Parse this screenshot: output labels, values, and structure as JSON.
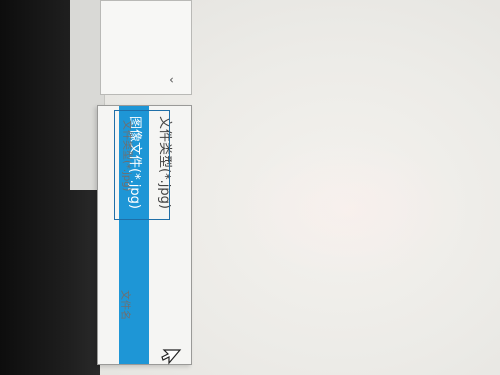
{
  "combo": {
    "arrow_icon": "chevron-down-icon"
  },
  "file_type_list": {
    "items": [
      {
        "label": "文件类型(*.jpg)",
        "selected": false
      },
      {
        "label": "图像文件(*.jpg)",
        "selected": true
      }
    ]
  },
  "faint_labels": {
    "below_left": "文件类型(*.jpg)",
    "below_mid": "文件名"
  },
  "colors": {
    "selection": "#1e96d6",
    "focus_border": "#1f6fa8"
  }
}
